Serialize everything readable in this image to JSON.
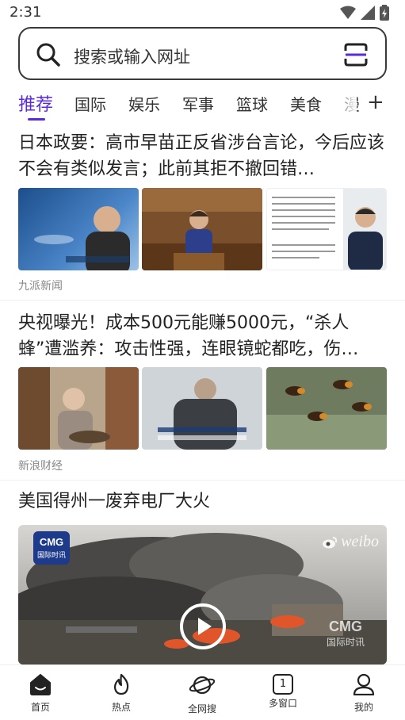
{
  "status": {
    "time": "2:31"
  },
  "search": {
    "placeholder": "搜索或输入网址"
  },
  "tabs": [
    {
      "label": "推荐",
      "active": true
    },
    {
      "label": "国际"
    },
    {
      "label": "娱乐"
    },
    {
      "label": "军事"
    },
    {
      "label": "篮球"
    },
    {
      "label": "美食"
    },
    {
      "label": "漫"
    }
  ],
  "feed": [
    {
      "title": "日本政要：高市早苗正反省涉台言论，今后应该不会有类似发言；此前其拒不撤回错…",
      "source": "九派新闻"
    },
    {
      "title": "央视曝光！成本500元能赚5000元，“杀人蜂”遭滥养：攻击性强，连眼镜蛇都吃，伤…",
      "source": "新浪财经"
    },
    {
      "title": "美国得州一废弃电厂大火",
      "video_logo_line1": "CMG",
      "video_logo_line2": "国际时讯",
      "video_watermark": "weibo",
      "video_corner_line1": "CMG",
      "video_corner_line2": "国际时讯"
    }
  ],
  "bottom_nav": [
    {
      "label": "首页",
      "icon": "home-icon"
    },
    {
      "label": "热点",
      "icon": "flame-icon"
    },
    {
      "label": "全网搜",
      "icon": "planet-icon"
    },
    {
      "label": "多窗口",
      "icon": "windows-icon",
      "count": "1"
    },
    {
      "label": "我的",
      "icon": "profile-icon"
    }
  ],
  "colors": {
    "accent": "#5b2bd9",
    "text": "#222222",
    "source": "#888888"
  }
}
